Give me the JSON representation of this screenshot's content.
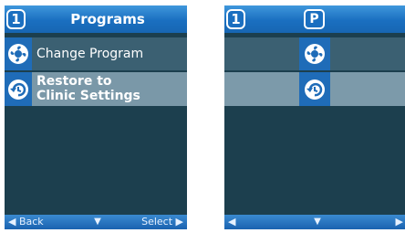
{
  "left_screen": {
    "header": {
      "program_number": "1",
      "title": "Programs"
    },
    "menu": [
      {
        "label": "Change Program",
        "icon": "fan-program-icon"
      },
      {
        "label_line1": "Restore to",
        "label_line2": "Clinic Settings",
        "icon": "restore-icon"
      }
    ],
    "footer": {
      "back": "◀ Back",
      "down": "▼",
      "select": "Select ▶"
    }
  },
  "right_screen": {
    "header": {
      "program_number": "1",
      "badge": "P"
    },
    "menu": [
      {
        "icon": "fan-program-icon"
      },
      {
        "icon": "restore-icon"
      }
    ],
    "footer": {
      "left": "◀",
      "down": "▼",
      "right": "▶"
    }
  },
  "colors": {
    "screen_bg": "#1c3f4e",
    "header_blue": "#1a6fc0",
    "row_normal": "#3b6072",
    "row_selected": "#7a98a8",
    "icon_bg": "#1f6cb8"
  }
}
